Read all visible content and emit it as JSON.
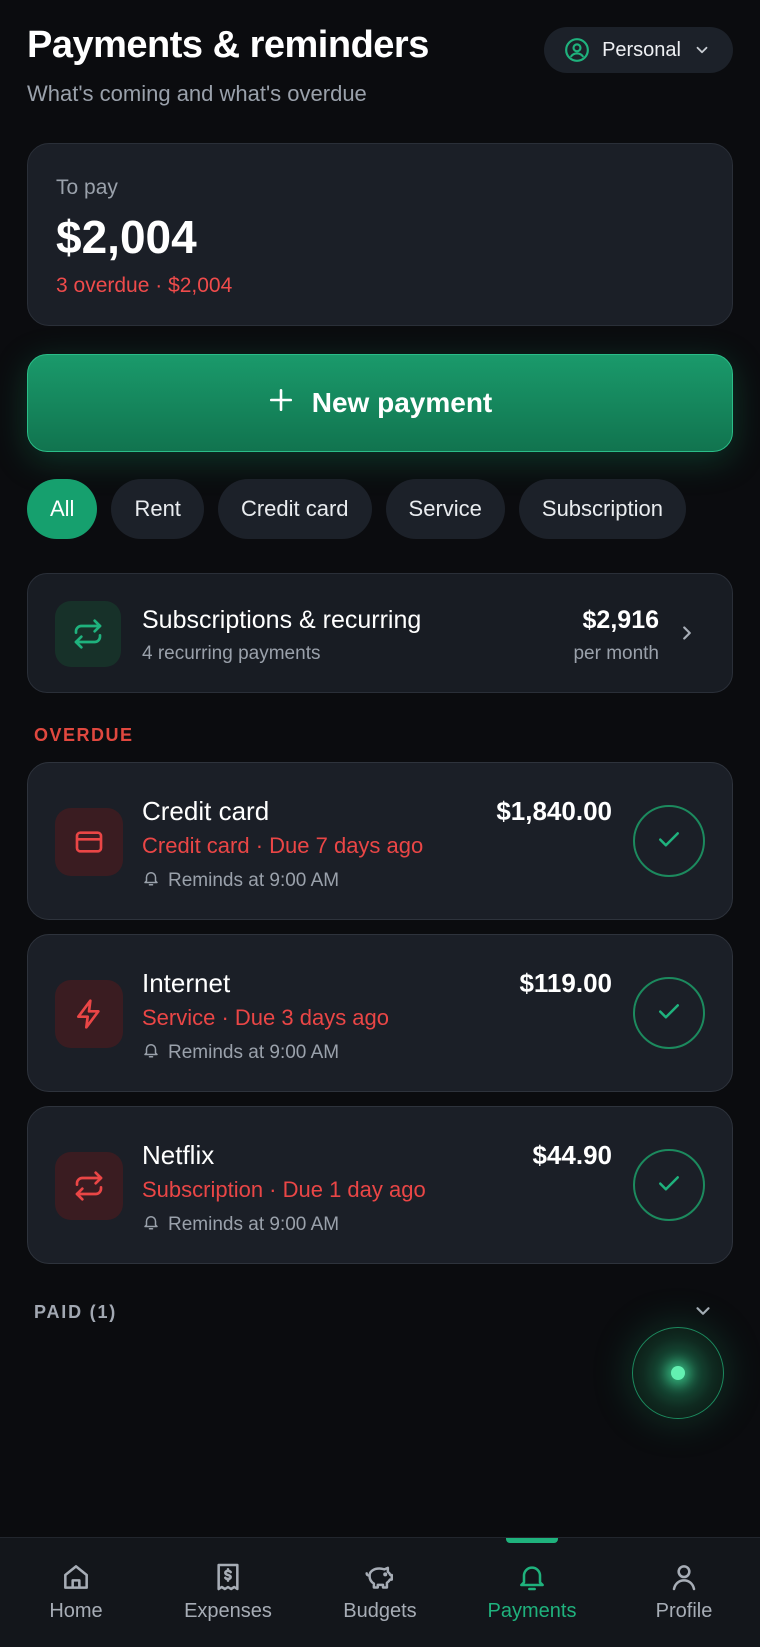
{
  "header": {
    "title": "Payments & reminders",
    "subtitle": "What's coming and what's overdue",
    "profile_switch": "Personal"
  },
  "summary": {
    "label": "To pay",
    "amount": "$2,004",
    "overdue_text": "3 overdue · $2,004"
  },
  "new_payment": {
    "label": "New payment"
  },
  "filters": {
    "selected": "All",
    "items": [
      "All",
      "Rent",
      "Credit card",
      "Service",
      "Subscription"
    ]
  },
  "recurring": {
    "title": "Subscriptions & recurring",
    "subtitle": "4 recurring payments",
    "amount": "$2,916",
    "period": "per month"
  },
  "sections": {
    "overdue": "OVERDUE",
    "paid": "PAID (1)"
  },
  "payments": [
    {
      "name": "Credit card",
      "meta": "Credit card · Due 7 days ago",
      "reminder": "Reminds at 9:00 AM",
      "amount": "$1,840.00",
      "icon": "credit-card-icon"
    },
    {
      "name": "Internet",
      "meta": "Service · Due 3 days ago",
      "reminder": "Reminds at 9:00 AM",
      "amount": "$119.00",
      "icon": "lightning-icon"
    },
    {
      "name": "Netflix",
      "meta": "Subscription · Due 1 day ago",
      "reminder": "Reminds at 9:00 AM",
      "amount": "$44.90",
      "icon": "repeat-icon"
    }
  ],
  "nav": {
    "active": "Payments",
    "items": [
      {
        "label": "Home",
        "icon": "home-icon"
      },
      {
        "label": "Expenses",
        "icon": "receipt-icon"
      },
      {
        "label": "Budgets",
        "icon": "piggy-bank-icon"
      },
      {
        "label": "Payments",
        "icon": "bell-icon"
      },
      {
        "label": "Profile",
        "icon": "user-icon"
      }
    ]
  },
  "colors": {
    "background": "#0b0c0f",
    "card": "#1b1f27",
    "accent_green": "#16a06e",
    "overdue_red": "#ea4646",
    "muted_text": "#9aa1ab"
  }
}
